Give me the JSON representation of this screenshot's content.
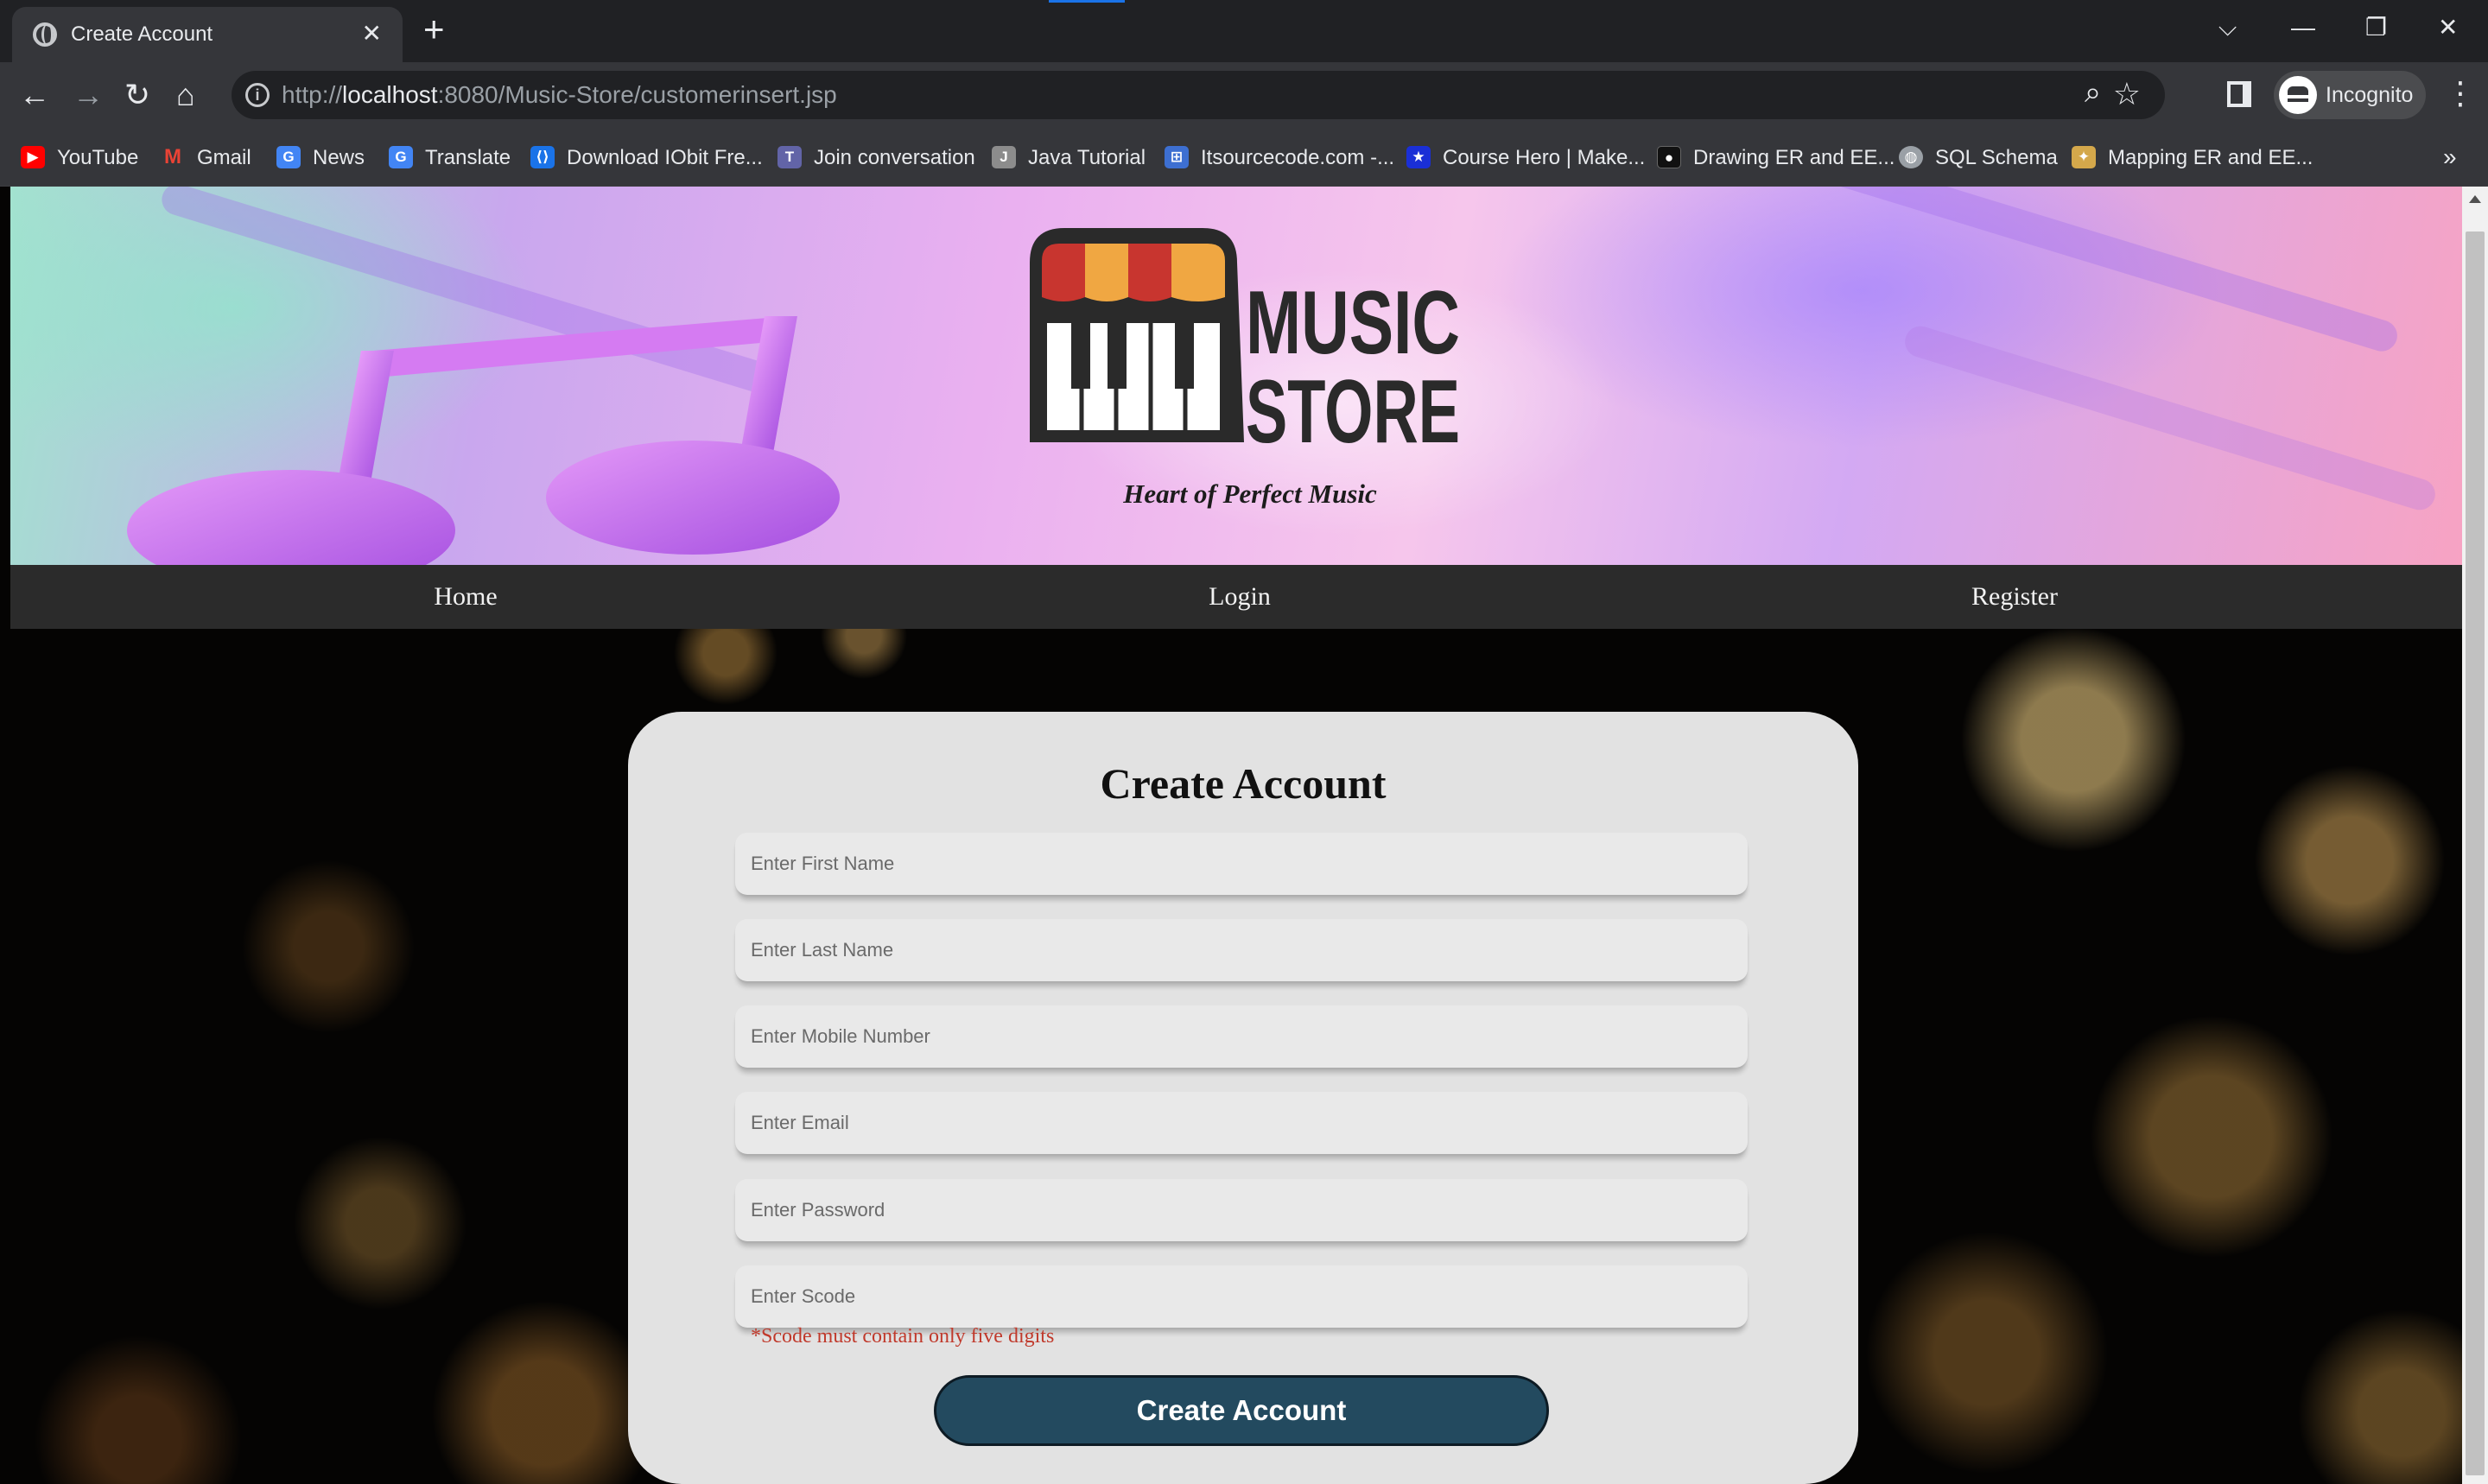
{
  "browser": {
    "tab_title": "Create Account",
    "new_tab": "+",
    "url_prefix": "http://",
    "url_host": "localhost",
    "url_rest": ":8080/Music-Store/customerinsert.jsp",
    "profile_label": "Incognito",
    "bookmarks": [
      {
        "label": "YouTube",
        "icon": "youtube-icon",
        "color": "#ff0000"
      },
      {
        "label": "Gmail",
        "icon": "gmail-icon",
        "color": "#ea4335"
      },
      {
        "label": "News",
        "icon": "google-news-icon",
        "color": "#4285f4"
      },
      {
        "label": "Translate",
        "icon": "google-translate-icon",
        "color": "#4285f4"
      },
      {
        "label": "Download IObit Fre...",
        "icon": "iobit-icon",
        "color": "#1a73e8"
      },
      {
        "label": "Join conversation",
        "icon": "teams-icon",
        "color": "#6264a7"
      },
      {
        "label": "Java Tutorial",
        "icon": "java-tutorial-icon",
        "color": "#8c8c8c"
      },
      {
        "label": "Itsourcecode.com -...",
        "icon": "itsourcecode-icon",
        "color": "#3d6fd1"
      },
      {
        "label": "Course Hero | Make...",
        "icon": "coursehero-icon",
        "color": "#1a2fd6"
      },
      {
        "label": "Drawing ER and EE...",
        "icon": "video-icon",
        "color": "#111111"
      },
      {
        "label": "SQL Schema",
        "icon": "globe-icon",
        "color": "#9aa0a6"
      },
      {
        "label": "Mapping ER and EE...",
        "icon": "ai-icon",
        "color": "#d4a84b"
      }
    ],
    "more_bookmarks": "»"
  },
  "site": {
    "logo_line1": "MUSIC",
    "logo_line2": "STORE",
    "tagline": "Heart of Perfect Music",
    "nav": [
      {
        "label": "Home"
      },
      {
        "label": "Login"
      },
      {
        "label": "Register"
      }
    ]
  },
  "form": {
    "title": "Create Account",
    "fields": [
      {
        "placeholder": "Enter First Name",
        "value": ""
      },
      {
        "placeholder": "Enter Last Name",
        "value": ""
      },
      {
        "placeholder": "Enter Mobile Number",
        "value": ""
      },
      {
        "placeholder": "Enter Email",
        "value": ""
      },
      {
        "placeholder": "Enter Password",
        "value": ""
      },
      {
        "placeholder": "Enter Scode",
        "value": ""
      }
    ],
    "hint": "*Scode must contain only five digits",
    "submit_label": "Create Account"
  },
  "colors": {
    "submit_bg": "#234a5f",
    "hint": "#c0392b",
    "card_bg": "#e2e2e2",
    "nav_bg": "#2b2b2b"
  }
}
